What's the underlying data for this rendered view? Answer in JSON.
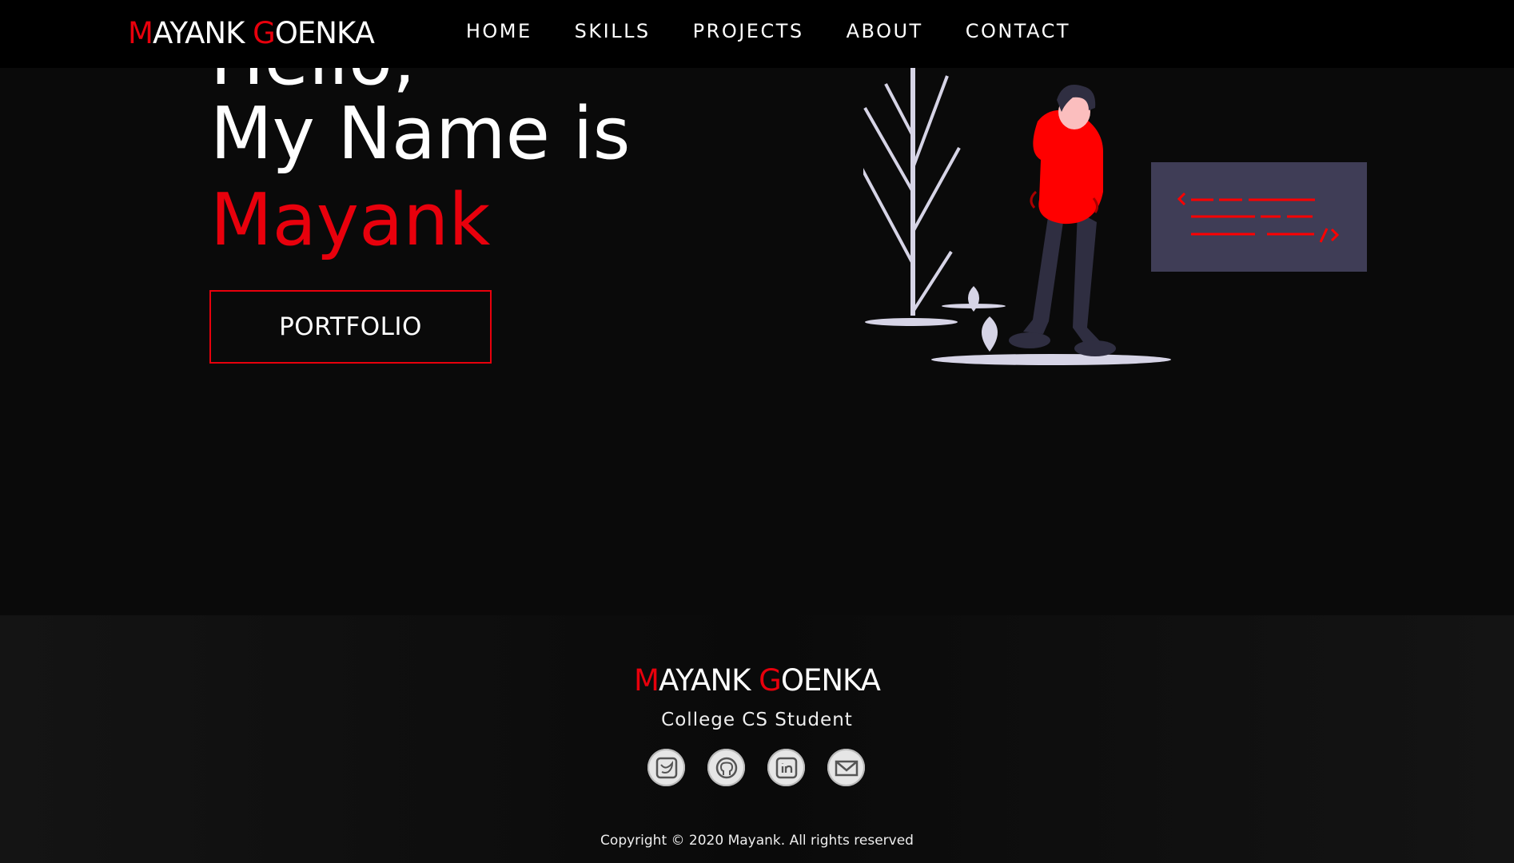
{
  "nav": {
    "logo": {
      "m": "M",
      "ayank": "AYANK ",
      "g": "G",
      "oenka": "OENKA"
    },
    "links": [
      "HOME",
      "SKILLS",
      "PROJECTS",
      "ABOUT",
      "CONTACT"
    ]
  },
  "hero": {
    "line1": "Hello,",
    "line2": "My Name is",
    "name": "Mayank",
    "button": "PORTFOLIO"
  },
  "footer": {
    "logo": {
      "m": "M",
      "ayank": "AYANK ",
      "g": "G",
      "oenka": "OENKA"
    },
    "subtitle": "College CS Student",
    "socials": [
      "twitter-icon",
      "github-icon",
      "linkedin-icon",
      "mail-icon"
    ],
    "copyright": "Copyright © 2020 Mayank. All rights reserved"
  },
  "colors": {
    "accent": "#e8000c",
    "background": "#0a0a0a",
    "navbar": "#000000",
    "code_panel": "#3f3d56"
  }
}
